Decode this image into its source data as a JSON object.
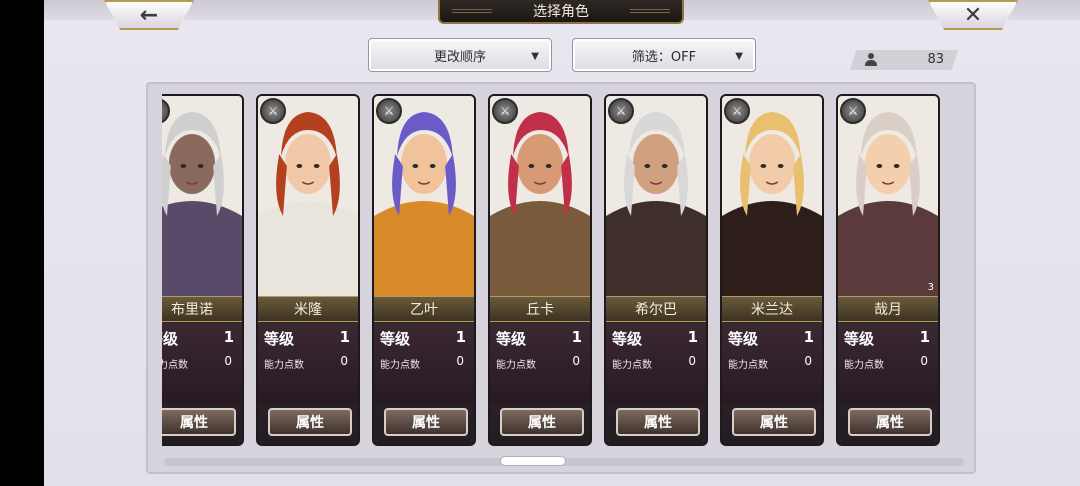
{
  "header": {
    "back_icon": "←",
    "close_icon": "✕",
    "title": "选择角色"
  },
  "toolbar": {
    "sort_label": "更改顺序",
    "filter_label": "筛选：OFF",
    "caret": "▼",
    "owned_icon": "person-icon",
    "owned_count": "83"
  },
  "labels": {
    "level": "等级",
    "ability_points": "能力点数",
    "attributes_button": "属性"
  },
  "characters": [
    {
      "name": "布里诺",
      "level": "1",
      "ability_points": "0",
      "hair": "#cfcfcf",
      "skin": "#8a6a5c",
      "outfit": "#5a4a6a"
    },
    {
      "name": "米隆",
      "level": "1",
      "ability_points": "0",
      "hair": "#b5401f",
      "skin": "#f1c9a8",
      "outfit": "#e9e4dc"
    },
    {
      "name": "乙叶",
      "level": "1",
      "ability_points": "0",
      "hair": "#6b5bc9",
      "skin": "#f0c39b",
      "outfit": "#d98a2b"
    },
    {
      "name": "丘卡",
      "level": "1",
      "ability_points": "0",
      "hair": "#c0304a",
      "skin": "#d69b74",
      "outfit": "#7a5a3c"
    },
    {
      "name": "希尔巴",
      "level": "1",
      "ability_points": "0",
      "hair": "#d8d8d8",
      "skin": "#d1a07e",
      "outfit": "#3e2f2a"
    },
    {
      "name": "米兰达",
      "level": "1",
      "ability_points": "0",
      "hair": "#e8c070",
      "skin": "#f2cba8",
      "outfit": "#2e1e1a"
    },
    {
      "name": "哉月",
      "level": "1",
      "ability_points": "0",
      "hair": "#d9cfc6",
      "skin": "#f3cfae",
      "outfit": "#5a3a3a",
      "badge": "3"
    }
  ]
}
